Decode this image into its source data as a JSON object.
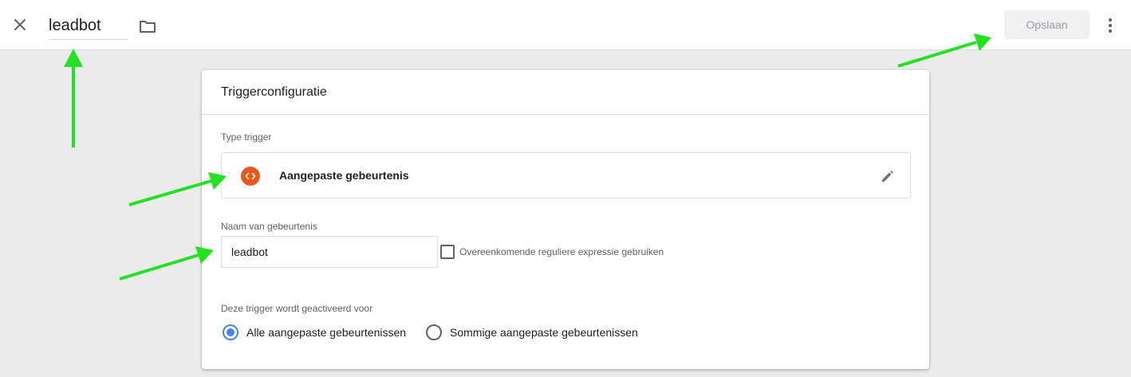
{
  "header": {
    "title": "leadbot",
    "save_label": "Opslaan",
    "close_icon": "close-icon",
    "folder_icon": "folder-icon",
    "more_icon": "more-vert-icon"
  },
  "card": {
    "title": "Triggerconfiguratie",
    "trigger_type": {
      "label": "Type trigger",
      "value": "Aangepaste gebeurtenis",
      "icon": "code-icon",
      "icon_color": "#e8591a",
      "edit_icon": "pencil-icon"
    },
    "event_name": {
      "label": "Naam van gebeurtenis",
      "value": "leadbot",
      "regex_checkbox_label": "Overeenkomende reguliere expressie gebruiken",
      "regex_checked": false
    },
    "fires_on": {
      "label": "Deze trigger wordt geactiveerd voor",
      "options": [
        {
          "label": "Alle aangepaste gebeurtenissen",
          "selected": true
        },
        {
          "label": "Sommige aangepaste gebeurtenissen",
          "selected": false
        }
      ]
    }
  },
  "colors": {
    "accent": "#4285f4",
    "annotation_arrow": "#22e222",
    "background": "#ebebeb"
  }
}
